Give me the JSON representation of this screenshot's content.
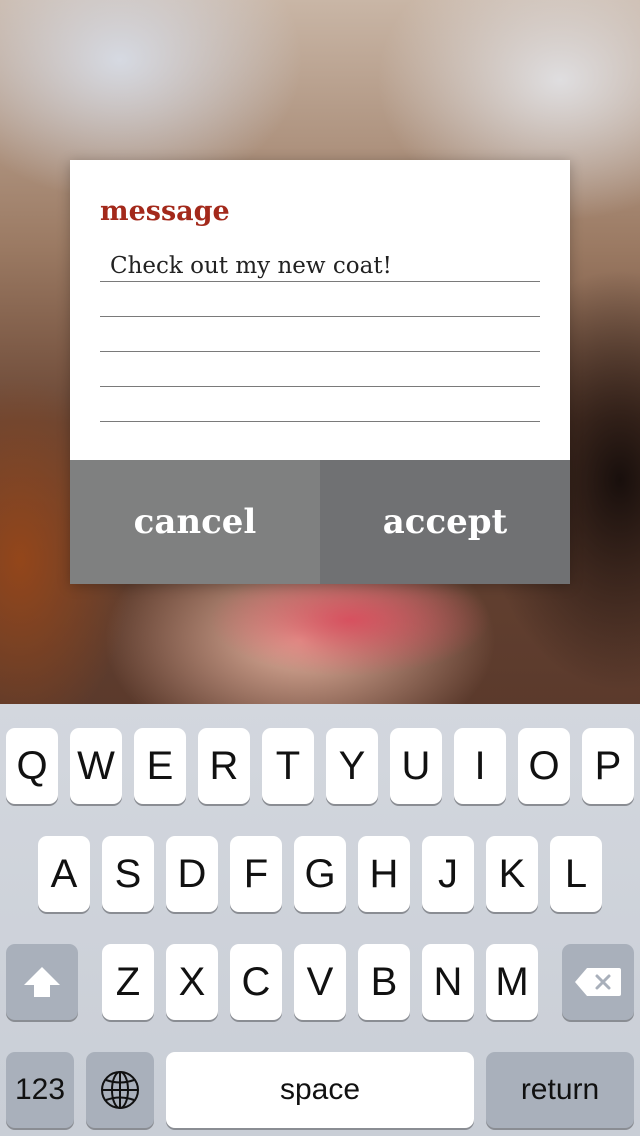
{
  "dialog": {
    "title": "message",
    "text_lines": [
      "Check out my new coat!",
      "",
      "",
      "",
      ""
    ],
    "cancel_label": "cancel",
    "accept_label": "accept"
  },
  "keyboard": {
    "row1": [
      "Q",
      "W",
      "E",
      "R",
      "T",
      "Y",
      "U",
      "I",
      "O",
      "P"
    ],
    "row2": [
      "A",
      "S",
      "D",
      "F",
      "G",
      "H",
      "J",
      "K",
      "L"
    ],
    "row3": [
      "Z",
      "X",
      "C",
      "V",
      "B",
      "N",
      "M"
    ],
    "numbers_label": "123",
    "space_label": "space",
    "return_label": "return"
  },
  "colors": {
    "title": "#a3291b",
    "cancel_bg": "#7f8080",
    "accept_bg": "#707173"
  }
}
